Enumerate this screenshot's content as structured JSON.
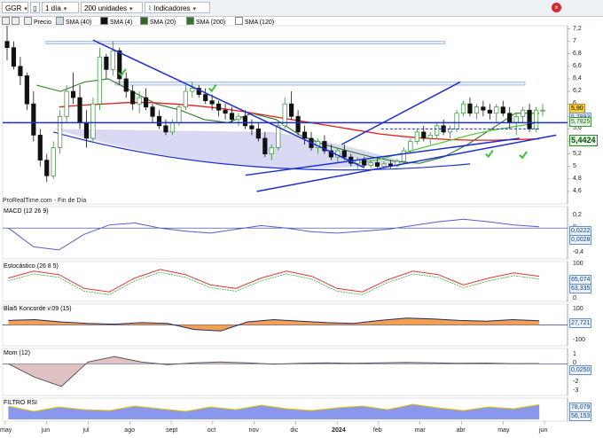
{
  "toolbar": {
    "symbol": "GGR",
    "period": "1 día",
    "units": "200 unidades",
    "indicators": "Indicadores"
  },
  "legend": [
    {
      "label": "Precio",
      "color": "#2e7d32"
    },
    {
      "label": "SMA (40)",
      "color": "#9aa3ad"
    },
    {
      "label": "SMA (4)",
      "color": "#111111"
    },
    {
      "label": "SMA (20)",
      "color": "#2e6b1a"
    },
    {
      "label": "SMA (200)",
      "color": "#c04040"
    },
    {
      "label": "SMA (120)",
      "color": "#ffffff"
    }
  ],
  "copyright": "ProRealTime.com - Fin de Día",
  "colors": {
    "up": "#2f8f2f",
    "down": "#111111",
    "trend": "#1c2fd1",
    "sma200": "#e0201c",
    "sma20": "#2f7a24",
    "sma120": "#5ac83c"
  },
  "chart_data": [
    {
      "type": "candlestick",
      "panel": "price",
      "ylim": [
        4.4,
        7.25
      ],
      "yticks": [
        "7,2",
        "7",
        "6,8",
        "6,6",
        "6,4",
        "6,2",
        "6",
        "5,8",
        "5,6",
        "5,4",
        "5,2",
        "5",
        "4,8",
        "4,6"
      ],
      "price_labels": {
        "last": "5,90",
        "close": "5,7825",
        "high": "5,7893",
        "current": "5,4424"
      },
      "months": [
        "may",
        "jun",
        "jul",
        "ago",
        "sept",
        "oct",
        "nov",
        "dic",
        "2024",
        "feb",
        "mar",
        "abr",
        "may",
        "jun"
      ],
      "candles": [
        [
          7.0,
          7.25,
          6.7,
          6.9
        ],
        [
          6.9,
          7.0,
          6.55,
          6.6
        ],
        [
          6.6,
          6.75,
          6.3,
          6.45
        ],
        [
          6.45,
          6.5,
          5.9,
          6.0
        ],
        [
          6.0,
          6.2,
          5.4,
          5.5
        ],
        [
          5.5,
          5.6,
          5.0,
          5.1
        ],
        [
          5.1,
          5.2,
          4.75,
          4.85
        ],
        [
          4.85,
          5.4,
          4.8,
          5.3
        ],
        [
          5.3,
          5.9,
          5.2,
          5.8
        ],
        [
          5.8,
          6.3,
          5.7,
          6.2
        ],
        [
          6.2,
          6.5,
          6.0,
          6.1
        ],
        [
          6.1,
          6.3,
          5.6,
          5.7
        ],
        [
          5.7,
          5.9,
          5.3,
          5.45
        ],
        [
          5.45,
          6.1,
          5.4,
          6.0
        ],
        [
          6.0,
          6.9,
          5.9,
          6.75
        ],
        [
          6.75,
          6.8,
          6.4,
          6.55
        ],
        [
          6.55,
          7.0,
          6.45,
          6.85
        ],
        [
          6.85,
          6.9,
          6.3,
          6.4
        ],
        [
          6.4,
          6.5,
          6.1,
          6.2
        ],
        [
          6.2,
          6.3,
          5.9,
          6.0
        ],
        [
          6.0,
          6.2,
          5.85,
          6.1
        ],
        [
          6.1,
          6.25,
          5.9,
          5.95
        ],
        [
          5.95,
          6.0,
          5.7,
          5.8
        ],
        [
          5.8,
          5.9,
          5.6,
          5.65
        ],
        [
          5.65,
          5.75,
          5.5,
          5.55
        ],
        [
          5.55,
          5.75,
          5.5,
          5.7
        ],
        [
          5.7,
          6.0,
          5.65,
          5.95
        ],
        [
          5.95,
          6.3,
          5.9,
          6.2
        ],
        [
          6.2,
          6.35,
          6.1,
          6.25
        ],
        [
          6.25,
          6.3,
          6.1,
          6.15
        ],
        [
          6.15,
          6.25,
          6.0,
          6.05
        ],
        [
          6.05,
          6.15,
          5.9,
          6.0
        ],
        [
          6.0,
          6.05,
          5.8,
          5.9
        ],
        [
          5.9,
          6.0,
          5.75,
          5.85
        ],
        [
          5.85,
          5.95,
          5.7,
          5.75
        ],
        [
          5.75,
          5.85,
          5.65,
          5.8
        ],
        [
          5.8,
          5.9,
          5.6,
          5.65
        ],
        [
          5.65,
          5.75,
          5.5,
          5.6
        ],
        [
          5.6,
          5.7,
          5.4,
          5.45
        ],
        [
          5.45,
          5.55,
          5.15,
          5.2
        ],
        [
          5.2,
          5.35,
          5.1,
          5.3
        ],
        [
          5.3,
          5.7,
          5.25,
          5.65
        ],
        [
          5.65,
          6.1,
          5.6,
          6.0
        ],
        [
          6.0,
          6.2,
          5.75,
          5.8
        ],
        [
          5.8,
          5.9,
          5.5,
          5.55
        ],
        [
          5.55,
          5.65,
          5.35,
          5.45
        ],
        [
          5.45,
          5.55,
          5.25,
          5.3
        ],
        [
          5.3,
          5.45,
          5.2,
          5.4
        ],
        [
          5.4,
          5.5,
          5.2,
          5.25
        ],
        [
          5.25,
          5.35,
          5.1,
          5.15
        ],
        [
          5.15,
          5.3,
          5.05,
          5.25
        ],
        [
          5.25,
          5.35,
          5.1,
          5.15
        ],
        [
          5.15,
          5.2,
          5.0,
          5.05
        ],
        [
          5.05,
          5.15,
          4.95,
          5.1
        ],
        [
          5.1,
          5.15,
          4.98,
          5.02
        ],
        [
          5.02,
          5.1,
          4.97,
          5.06
        ],
        [
          5.06,
          5.12,
          4.98,
          5.0
        ],
        [
          5.0,
          5.08,
          4.96,
          5.04
        ],
        [
          5.04,
          5.1,
          4.97,
          5.01
        ],
        [
          5.01,
          5.12,
          4.98,
          5.08
        ],
        [
          5.08,
          5.3,
          5.05,
          5.25
        ],
        [
          5.25,
          5.45,
          5.2,
          5.4
        ],
        [
          5.4,
          5.6,
          5.35,
          5.55
        ],
        [
          5.55,
          5.65,
          5.4,
          5.45
        ],
        [
          5.45,
          5.55,
          5.35,
          5.5
        ],
        [
          5.5,
          5.7,
          5.45,
          5.65
        ],
        [
          5.65,
          5.75,
          5.5,
          5.55
        ],
        [
          5.55,
          5.65,
          5.45,
          5.6
        ],
        [
          5.6,
          5.9,
          5.55,
          5.85
        ],
        [
          5.85,
          6.05,
          5.8,
          6.0
        ],
        [
          6.0,
          6.1,
          5.8,
          5.85
        ],
        [
          5.85,
          6.0,
          5.75,
          5.95
        ],
        [
          5.95,
          6.05,
          5.8,
          5.9
        ],
        [
          5.9,
          6.0,
          5.75,
          5.85
        ],
        [
          5.85,
          6.0,
          5.7,
          5.95
        ],
        [
          5.95,
          6.05,
          5.8,
          5.85
        ],
        [
          5.85,
          5.95,
          5.6,
          5.7
        ],
        [
          5.7,
          5.85,
          5.5,
          5.8
        ],
        [
          5.8,
          5.95,
          5.7,
          5.9
        ],
        [
          5.9,
          6.0,
          5.55,
          5.6
        ],
        [
          5.6,
          5.95,
          5.55,
          5.9
        ],
        [
          5.9,
          6.0,
          5.8,
          5.9
        ]
      ],
      "sma200": [
        5.95,
        5.98,
        6.0,
        6.02,
        6.02,
        6.0,
        5.97,
        5.93,
        5.88,
        5.82,
        5.76,
        5.7,
        5.64,
        5.58,
        5.52,
        5.48,
        5.45,
        5.43,
        5.42,
        5.42,
        5.43,
        5.44
      ],
      "sma20": [
        6.3,
        6.2,
        6.35,
        6.4,
        6.2,
        6.0,
        5.9,
        5.75,
        5.7,
        5.85,
        5.75,
        5.5,
        5.35,
        5.25,
        5.15,
        5.08,
        5.05,
        5.15,
        5.35,
        5.6,
        5.85,
        5.85
      ],
      "sma120": [
        5.05,
        5.1,
        5.2,
        5.3,
        5.4,
        5.5,
        5.58,
        5.64,
        5.7
      ],
      "trendlines": [
        {
          "from": [
            0.16,
            7.02
          ],
          "to": [
            0.64,
            4.98
          ]
        },
        {
          "from": [
            0.43,
            4.86
          ],
          "to": [
            0.915,
            5.45
          ]
        },
        {
          "from": [
            0.6,
            5.35
          ],
          "to": [
            0.81,
            6.35
          ]
        },
        {
          "from": [
            0.0,
            5.7
          ],
          "to": [
            1.0,
            5.7
          ]
        }
      ]
    },
    {
      "type": "line",
      "panel": "macd",
      "name": "MACD (12 26 9)",
      "yticks": [
        "0,2",
        "0",
        "-0,2",
        "-0,4"
      ],
      "ylim": [
        -0.45,
        0.3
      ],
      "last_values": [
        "0,0222",
        "0,0028"
      ],
      "values": [
        0.0,
        -0.3,
        -0.35,
        -0.1,
        0.05,
        0.08,
        0.0,
        -0.05,
        -0.08,
        -0.02,
        0.04,
        0.0,
        -0.06,
        -0.08,
        -0.05,
        -0.02,
        0.04,
        0.1,
        0.14,
        0.1,
        0.05,
        0.02
      ]
    },
    {
      "type": "line",
      "panel": "stochastic",
      "name": "Estocástico (26 8 5)",
      "yticks": [
        "100",
        "0"
      ],
      "ylim": [
        0,
        100
      ],
      "last_values": [
        "65,074",
        "63,335"
      ],
      "values": [
        60,
        80,
        70,
        30,
        20,
        60,
        85,
        70,
        40,
        30,
        60,
        80,
        65,
        30,
        20,
        55,
        80,
        70,
        40,
        60,
        75,
        65
      ]
    },
    {
      "type": "area",
      "panel": "koncorde",
      "name": "Blai5 Koncorde v.09 (15)",
      "yticks": [
        "100",
        "0",
        "-100"
      ],
      "ylim": [
        -120,
        120
      ],
      "last_values": [
        "27,721"
      ],
      "values": [
        30,
        35,
        20,
        10,
        5,
        15,
        10,
        -30,
        -40,
        20,
        35,
        25,
        15,
        10,
        30,
        45,
        40,
        30,
        25,
        35,
        28
      ]
    },
    {
      "type": "line",
      "panel": "momentum",
      "name": "Mom (12)",
      "yticks": [
        "1",
        "0",
        "-1",
        "-2",
        "-3"
      ],
      "ylim": [
        -3.2,
        1.4
      ],
      "last_values": [
        "0,0250"
      ],
      "values": [
        0,
        -1.5,
        -2.5,
        0.2,
        0.8,
        0.2,
        -0.1,
        0.1,
        0.2,
        0.1,
        -0.05,
        0.05,
        0.1,
        0.05,
        0.1,
        0.15,
        0.1,
        0.05,
        0.08,
        0.02,
        0.03
      ]
    },
    {
      "type": "line",
      "panel": "rsi",
      "name": "FILTRO RSI",
      "last_values": [
        "78,079",
        "56,153"
      ],
      "values": [
        70,
        40,
        65,
        50,
        45,
        70,
        55,
        40,
        65,
        50,
        75,
        55,
        45,
        60,
        70,
        50,
        80,
        60,
        45,
        65,
        55,
        78
      ]
    }
  ]
}
